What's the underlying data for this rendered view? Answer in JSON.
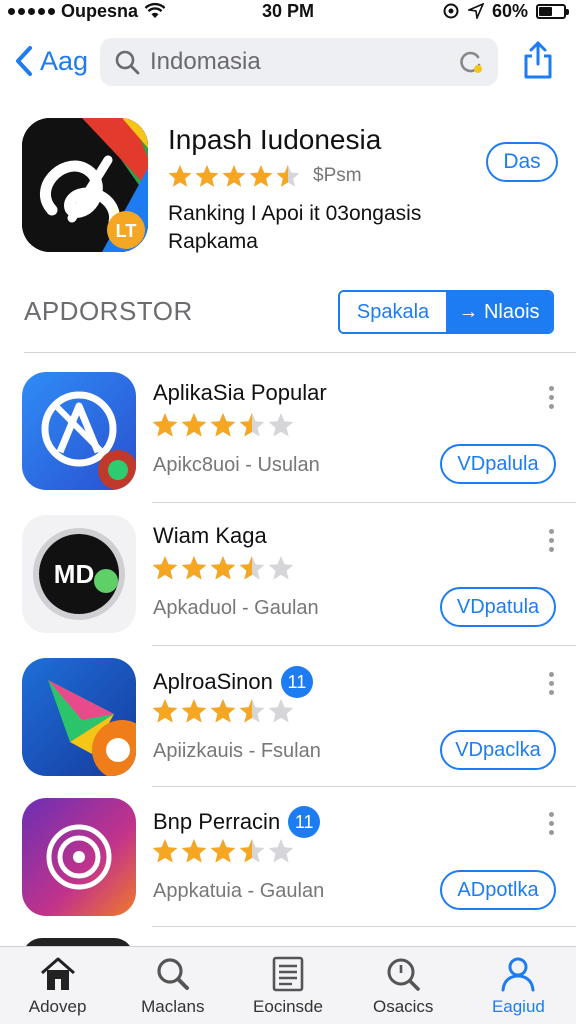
{
  "status_bar": {
    "carrier": "Oupesna",
    "time": "30 PM",
    "battery_percent": "60%",
    "battery_level": 0.6
  },
  "nav": {
    "back_label": "Aag",
    "search_value": "Indomasia",
    "search_placeholder": "Indomasia"
  },
  "hero": {
    "title": "Inpash Iudonesia",
    "rating": 4.5,
    "price": "$Psm",
    "description_line1": "Ranking I Apoi it 03ongasis",
    "description_line2": "Rapkama",
    "button_label": "Das"
  },
  "section": {
    "title": "APDORSTOR",
    "segment_left": "Spakala",
    "segment_right": "→ Nlaois"
  },
  "apps": [
    {
      "title": "AplikaSia Popular",
      "badge": "",
      "rating": 3.5,
      "subtitle": "Apikc8uoi - Usulan",
      "button": "VDpalula"
    },
    {
      "title": "Wiam Kaga",
      "badge": "",
      "rating": 3.5,
      "subtitle": "Apkaduol - Gaulan",
      "button": "VDpatula"
    },
    {
      "title": "AplroaSinon",
      "badge": "11",
      "rating": 3.5,
      "subtitle": "Apiizkauis - Fsulan",
      "button": "VDpaclka"
    },
    {
      "title": "Bnp Perracin",
      "badge": "11",
      "rating": 3.5,
      "subtitle": "Appkatuia - Gaulan",
      "button": "ADpotlka"
    }
  ],
  "tabs": [
    {
      "label": "Adovep",
      "icon": "home-icon",
      "active": false
    },
    {
      "label": "Maclans",
      "icon": "search-icon",
      "active": false
    },
    {
      "label": "Eocinsde",
      "icon": "list-icon",
      "active": false
    },
    {
      "label": "Osacics",
      "icon": "search-icon",
      "active": false
    },
    {
      "label": "Eagiud",
      "icon": "user-icon",
      "active": true
    }
  ],
  "colors": {
    "accent": "#1e7cf2",
    "star": "#f5a623",
    "star_empty": "#d6d6da"
  }
}
